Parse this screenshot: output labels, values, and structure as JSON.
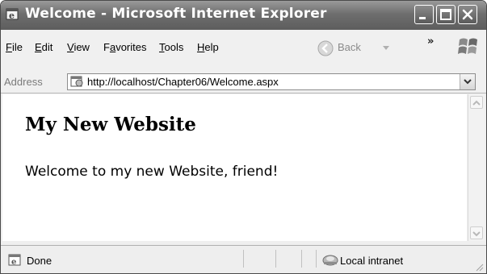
{
  "window": {
    "title": "Welcome - Microsoft Internet Explorer",
    "icon": "ie-logo-icon",
    "controls": [
      "minimize-icon",
      "maximize-icon",
      "close-icon"
    ]
  },
  "menu": {
    "items": [
      {
        "label": "File",
        "key": "F"
      },
      {
        "label": "Edit",
        "key": "E"
      },
      {
        "label": "View",
        "key": "V"
      },
      {
        "label": "Favorites",
        "key": "a"
      },
      {
        "label": "Tools",
        "key": "T"
      },
      {
        "label": "Help",
        "key": "H"
      }
    ],
    "back_label": "Back",
    "more_label": "»"
  },
  "address": {
    "label": "Address",
    "url": "http://localhost/Chapter06/Welcome.aspx"
  },
  "page": {
    "heading": "My New Website",
    "body": "Welcome to my new Website, friend!"
  },
  "status": {
    "text": "Done",
    "zone": "Local intranet"
  }
}
